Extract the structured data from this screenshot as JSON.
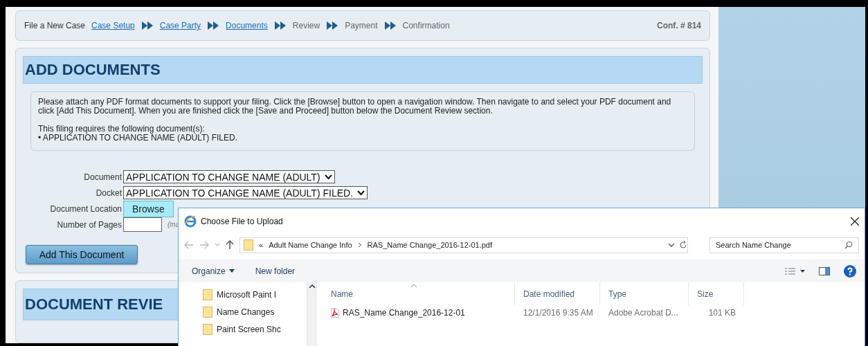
{
  "breadcrumb": {
    "lead": "File a New Case",
    "steps": [
      {
        "label": "Case Setup",
        "link": true
      },
      {
        "label": "Case Party",
        "link": true
      },
      {
        "label": "Documents",
        "link": true
      },
      {
        "label": "Review",
        "link": false
      },
      {
        "label": "Payment",
        "link": false
      },
      {
        "label": "Confirmation",
        "link": false
      }
    ],
    "conf": "Conf. # 814"
  },
  "add_documents": {
    "title": "ADD DOCUMENTS",
    "instructions": "Please attach any PDF format documents to support your filing. Click the [Browse] button to open a navigation window. Then navigate to and select your PDF document and click [Add This Document]. When you are finished click the [Save and Proceed] button below the Document Review section.",
    "requirement_heading": "This filing requires the following document(s):",
    "requirements": [
      "• APPLICATION TO CHANGE NAME (ADULT) FILED."
    ],
    "fields": [
      {
        "kind": "select",
        "label": "Document",
        "value": "APPLICATION TO CHANGE NAME (ADULT)"
      },
      {
        "kind": "select",
        "label": "Docket",
        "value": "APPLICATION TO CHANGE NAME (ADULT) FILED."
      },
      {
        "kind": "button",
        "label": "Document Location",
        "button": "Browse"
      },
      {
        "kind": "input",
        "label": "Number of Pages",
        "note": "(ma"
      }
    ],
    "submit": "Add This Document"
  },
  "document_review": {
    "title": "DOCUMENT REVIE"
  },
  "dialog": {
    "title": "Choose File to Upload",
    "path": [
      "«",
      "Adult Name Change Info",
      "RAS_Name Change_2016-12-01.pdf"
    ],
    "search_placeholder": "Search Name Change",
    "toolbar": [
      "Organize",
      "New folder"
    ],
    "folders": [
      "Microsoft Paint I",
      "Name Changes",
      "Paint Screen Shc"
    ],
    "columns": [
      "Name",
      "Date modified",
      "Type",
      "Size"
    ],
    "files": [
      {
        "name": "RAS_Name Change_2016-12-01",
        "date": "12/1/2016 9:35 AM",
        "type": "Adobe Acrobat D...",
        "size": "101 KB"
      }
    ]
  }
}
